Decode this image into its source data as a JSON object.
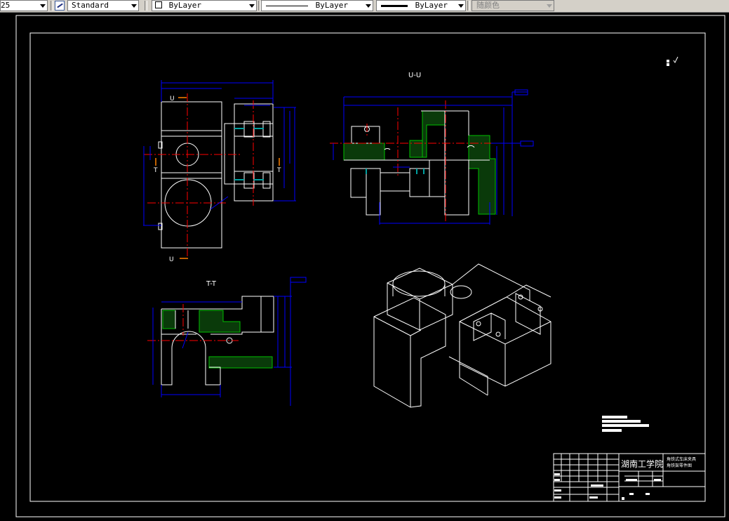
{
  "toolbar": {
    "scale_value": "25",
    "text_style": "Standard",
    "layer": "ByLayer",
    "linetype": "ByLayer",
    "lineweight": "ByLayer",
    "plot_style": "随颜色"
  },
  "drawing": {
    "view_u_label": "U-U",
    "view_t_label": "T-T",
    "section_u": "U",
    "section_t": "T",
    "title_block": {
      "school": "湖南工学院",
      "title_line1": "角铁式车床夹具",
      "title_line2": "角铁架零件图"
    }
  },
  "colors": {
    "background": "#000000",
    "outline": "#ffffff",
    "dimension": "#0000ff",
    "centerline": "#ff0000",
    "hatch": "#00a000",
    "section_arrow": "#ff8000"
  }
}
